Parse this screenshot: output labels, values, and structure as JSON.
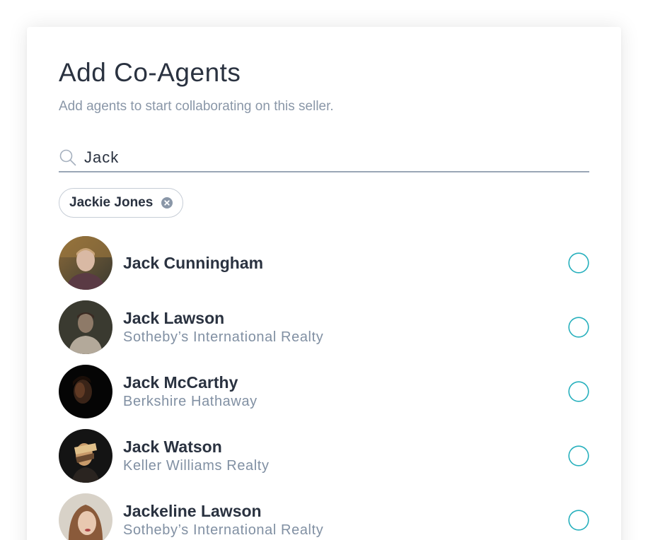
{
  "header": {
    "title": "Add Co-Agents",
    "subtitle": "Add agents to start collaborating on this seller."
  },
  "search": {
    "value": "Jack",
    "icon": "search-icon"
  },
  "selected_chips": [
    {
      "label": "Jackie Jones",
      "remove_icon": "close-circle-icon"
    }
  ],
  "agents": [
    {
      "name": "Jack Cunningham",
      "company": "",
      "selected": false
    },
    {
      "name": "Jack Lawson",
      "company": "Sotheby’s International Realty",
      "selected": false
    },
    {
      "name": "Jack McCarthy",
      "company": "Berkshire Hathaway",
      "selected": false
    },
    {
      "name": "Jack Watson",
      "company": "Keller Williams Realty",
      "selected": false
    },
    {
      "name": "Jackeline Lawson",
      "company": "Sotheby’s International Realty",
      "selected": false
    }
  ],
  "colors": {
    "accent": "#27b0bd",
    "title_text": "#2a3240",
    "muted_text": "#8190a3",
    "chip_border": "#c6cdd6"
  }
}
